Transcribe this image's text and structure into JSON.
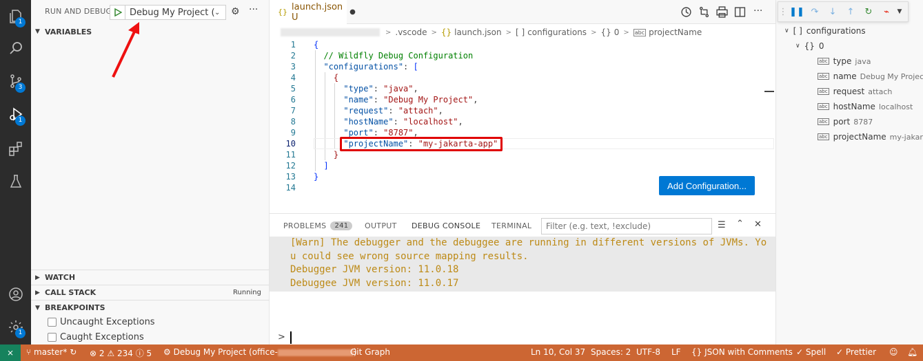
{
  "activity": {
    "badges": {
      "explorer": "1",
      "scm": "3",
      "debug": "1",
      "accounts": "1"
    }
  },
  "sidebar": {
    "header": "RUN AND DEBUG",
    "config_name": "Debug My Project (office-",
    "sections": {
      "variables": "VARIABLES",
      "watch": "WATCH",
      "call_stack": "CALL STACK",
      "call_stack_status": "Running",
      "breakpoints": "BREAKPOINTS"
    },
    "breakpoints": [
      "Uncaught Exceptions",
      "Caught Exceptions"
    ]
  },
  "editor": {
    "tab": {
      "icon": "{}",
      "label": "launch.json U"
    },
    "breadcrumb": {
      "folder": ".vscode",
      "file": "launch.json",
      "configurations": "configurations",
      "index": "0",
      "prop": "projectName"
    },
    "lines": [
      {
        "n": "1",
        "parts": [
          [
            "p",
            "{"
          ]
        ]
      },
      {
        "n": "2",
        "parts": [
          [
            "c",
            "  // Wildfly Debug Configuration"
          ]
        ]
      },
      {
        "n": "3",
        "parts": [
          [
            "k",
            "  \"configurations\""
          ],
          [
            "t",
            ": "
          ],
          [
            "p",
            "["
          ]
        ]
      },
      {
        "n": "4",
        "parts": [
          [
            "s",
            "    {"
          ]
        ]
      },
      {
        "n": "5",
        "parts": [
          [
            "k",
            "      \"type\""
          ],
          [
            "t",
            ": "
          ],
          [
            "s",
            "\"java\""
          ],
          [
            "t",
            ","
          ]
        ]
      },
      {
        "n": "6",
        "parts": [
          [
            "k",
            "      \"name\""
          ],
          [
            "t",
            ": "
          ],
          [
            "s",
            "\"Debug My Project\""
          ],
          [
            "t",
            ","
          ]
        ]
      },
      {
        "n": "7",
        "parts": [
          [
            "k",
            "      \"request\""
          ],
          [
            "t",
            ": "
          ],
          [
            "s",
            "\"attach\""
          ],
          [
            "t",
            ","
          ]
        ]
      },
      {
        "n": "8",
        "parts": [
          [
            "k",
            "      \"hostName\""
          ],
          [
            "t",
            ": "
          ],
          [
            "s",
            "\"localhost\""
          ],
          [
            "t",
            ","
          ]
        ]
      },
      {
        "n": "9",
        "parts": [
          [
            "k",
            "      \"port\""
          ],
          [
            "t",
            ": "
          ],
          [
            "s",
            "\"8787\""
          ],
          [
            "t",
            ","
          ]
        ]
      },
      {
        "n": "10",
        "parts": [
          [
            "k",
            "      \"projectName\""
          ],
          [
            "t",
            ": "
          ],
          [
            "s",
            "\"my-jakarta-app\""
          ]
        ]
      },
      {
        "n": "11",
        "parts": [
          [
            "s",
            "    }"
          ]
        ]
      },
      {
        "n": "12",
        "parts": [
          [
            "p",
            "  ]"
          ]
        ]
      },
      {
        "n": "13",
        "parts": [
          [
            "p",
            "}"
          ]
        ]
      },
      {
        "n": "14",
        "parts": []
      }
    ],
    "add_config_label": "Add Configuration..."
  },
  "panel": {
    "tabs": {
      "problems": "PROBLEMS",
      "problems_count": "241",
      "output": "OUTPUT",
      "debug_console": "DEBUG CONSOLE",
      "terminal": "TERMINAL"
    },
    "filter_placeholder": "Filter (e.g. text, !exclude)",
    "console_lines": [
      "[Warn] The debugger and the debuggee are running in different versions of JVMs. Yo",
      "u could see wrong source mapping results.",
      "Debugger JVM version: 11.0.18",
      "Debuggee JVM version: 11.0.17"
    ],
    "prompt": ">"
  },
  "outline": {
    "root": "configurations",
    "index": "0",
    "items": [
      {
        "key": "type",
        "value": "java"
      },
      {
        "key": "name",
        "value": "Debug My Project"
      },
      {
        "key": "request",
        "value": "attach"
      },
      {
        "key": "hostName",
        "value": "localhost"
      },
      {
        "key": "port",
        "value": "8787"
      },
      {
        "key": "projectName",
        "value": "my-jakar..."
      }
    ]
  },
  "status": {
    "branch": "master*",
    "errors": "2",
    "warnings": "234",
    "infos": "5",
    "debug_session": "Debug My Project (office-",
    "debug_session_end": ")",
    "git_graph": "Git Graph",
    "position": "Ln 10, Col 37",
    "spaces": "Spaces: 2",
    "encoding": "UTF-8",
    "eol": "LF",
    "language": "JSON with Comments",
    "spell": "Spell",
    "prettier": "Prettier"
  },
  "colors": {
    "status_bar": "#cc6633",
    "accent": "#0078d4",
    "highlight": "#e00000"
  }
}
